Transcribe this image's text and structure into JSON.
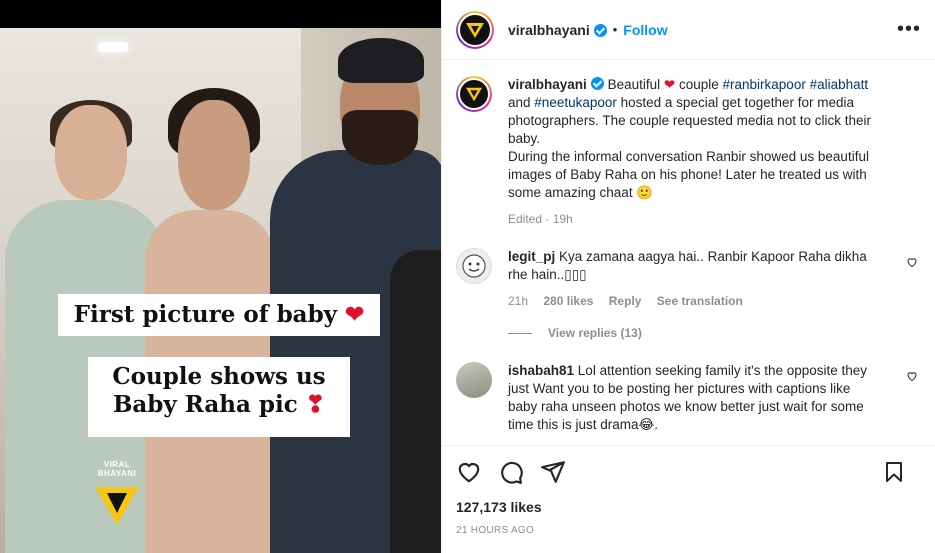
{
  "photo": {
    "caption_line1": "First picture of baby",
    "caption_line2a": "Couple shows us",
    "caption_line2b": "Baby Raha pic",
    "caption_heart1": "❤",
    "caption_heart2": "❣",
    "watermark": "VIRAL BHAYANI"
  },
  "header": {
    "username": "viralbhayani",
    "separator": "•",
    "follow": "Follow",
    "more": "•••"
  },
  "post": {
    "username": "viralbhayani",
    "text_before_heart": "Beautiful",
    "heart": "❤",
    "text_after_heart": "couple",
    "tag1": "#ranbirkapoor",
    "tag2": "#aliabhatt",
    "and": "and",
    "tag3": "#neetukapoor",
    "body1": "hosted a special get together for media photographers. The couple requested media not to click their baby.",
    "body2": "During the informal conversation Ranbir showed us beautiful images of Baby Raha on his phone! Later he treated us with some amazing chaat",
    "emoji": "🙂",
    "edited": "Edited",
    "meta_dot": "·",
    "age": "19h"
  },
  "comments": [
    {
      "username": "legit_pj",
      "text": "Kya zamana aagya hai.. Ranbir Kapoor Raha dikha rhe hain..▯▯▯",
      "age": "21h",
      "likes": "280 likes",
      "reply": "Reply",
      "translate": "See translation",
      "view_replies": "View replies (13)"
    },
    {
      "username": "ishabah81",
      "text": "Lol attention seeking family it's the opposite they just Want you to be posting her pictures with captions like baby raha unseen photos we know better just wait for some time this is just drama😂."
    }
  ],
  "footer": {
    "likes": "127,173 likes",
    "time": "21 HOURS AGO"
  },
  "colors": {
    "link_blue": "#0095f6",
    "tag_blue": "#00376b",
    "muted": "#8e8e8e",
    "heart_red": "#e0112b"
  }
}
